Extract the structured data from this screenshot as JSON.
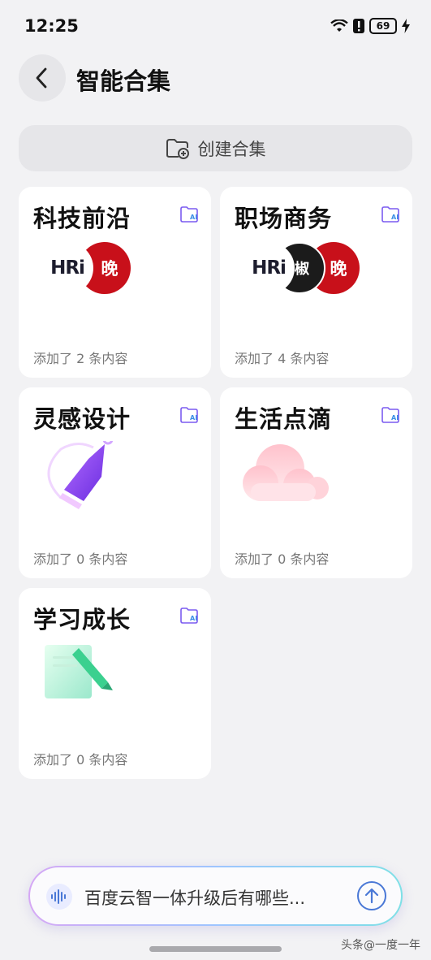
{
  "status_bar": {
    "time": "12:25",
    "battery": "69"
  },
  "header": {
    "title": "智能合集",
    "back_icon": "chevron-left-icon"
  },
  "create_button": {
    "label": "创建合集",
    "icon": "folder-add-icon"
  },
  "collections": [
    {
      "title": "科技前沿",
      "count_text": "添加了 2 条内容",
      "logos": [
        "HRi",
        "晚"
      ]
    },
    {
      "title": "职场商务",
      "count_text": "添加了 4 条内容",
      "logos": [
        "HRi",
        "椒",
        "晚"
      ]
    },
    {
      "title": "灵感设计",
      "count_text": "添加了 0 条内容",
      "art": "pen-icon"
    },
    {
      "title": "生活点滴",
      "count_text": "添加了 0 条内容",
      "art": "cloud-icon"
    },
    {
      "title": "学习成长",
      "count_text": "添加了 0 条内容",
      "art": "notebook-icon"
    }
  ],
  "ask_bar": {
    "text": "百度云智一体升级后有哪些...",
    "voice_icon": "voice-wave-icon",
    "send_icon": "arrow-up-icon"
  },
  "watermark": "头条@一度一年",
  "colors": {
    "background": "#f2f2f4",
    "card": "#ffffff",
    "accent": "#4a78d6",
    "logo_red": "#c8101a"
  }
}
